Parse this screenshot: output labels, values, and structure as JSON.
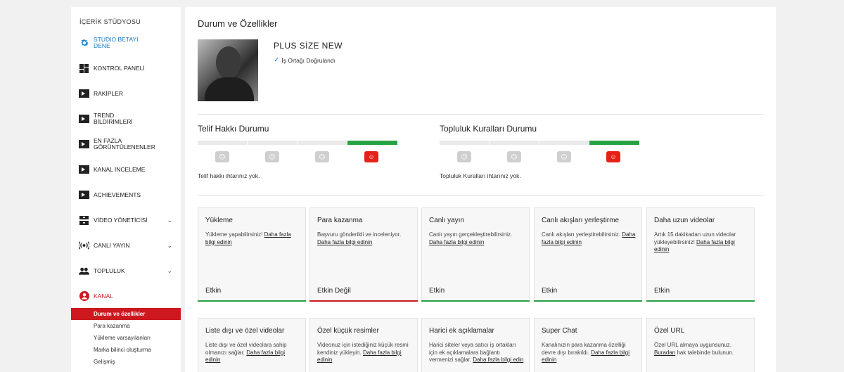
{
  "sidebar": {
    "header": "İÇERİK STÜDYOSU",
    "items": [
      {
        "label": "STUDIO BETAYI DENE",
        "icon": "gear-icon"
      },
      {
        "label": "KONTROL PANELİ",
        "icon": "dashboard-icon"
      },
      {
        "label": "RAKİPLER",
        "icon": "video-thumb-icon"
      },
      {
        "label": "TREND BİLDİRİMLERİ",
        "icon": "video-thumb-icon"
      },
      {
        "label": "EN FAZLA GÖRÜNTÜLENENLER",
        "icon": "video-thumb-icon"
      },
      {
        "label": "KANAL İNCELEME",
        "icon": "video-thumb-icon"
      },
      {
        "label": "ACHIEVEMENTS",
        "icon": "video-thumb-icon"
      },
      {
        "label": "VİDEO YÖNETİCİSİ",
        "icon": "video-manager-icon"
      },
      {
        "label": "CANLI YAYIN",
        "icon": "live-icon"
      },
      {
        "label": "TOPLULUK",
        "icon": "community-icon"
      },
      {
        "label": "KANAL",
        "icon": "account-icon"
      }
    ],
    "subitems": [
      {
        "label": "Durum ve özellikler"
      },
      {
        "label": "Para kazanma"
      },
      {
        "label": "Yükleme varsayılanları"
      },
      {
        "label": "Marka bilinci oluşturma"
      },
      {
        "label": "Gelişmiş"
      }
    ]
  },
  "main": {
    "title": "Durum ve Özellikler",
    "channel_name": "PLUS SİZE NEW",
    "verified_label": "İş Ortağı Doğrulandı",
    "copyright": {
      "title": "Telif Hakkı Durumu",
      "text": "Telif hakkı ihtarınız yok."
    },
    "community": {
      "title": "Topluluk Kuralları Durumu",
      "text": "Topluluk Kuralları ihtarınız yok."
    },
    "cards": [
      {
        "title": "Yükleme",
        "desc": "Yükleme yapabilirsiniz!",
        "link": "Daha fazla bilgi edinin",
        "state": "Etkin"
      },
      {
        "title": "Para kazanma",
        "desc": "Başvuru gönderildi ve inceleniyor.",
        "link": "Daha fazla bilgi edinin",
        "state": "Etkin Değil"
      },
      {
        "title": "Canlı yayın",
        "desc": "Canlı yayın gerçekleştirebilirsiniz.",
        "link": "Daha fazla bilgi edinin",
        "state": "Etkin"
      },
      {
        "title": "Canlı akışları yerleştirme",
        "desc": "Canlı akışları yerleştirebilirsiniz.",
        "link": "Daha fazla bilgi edinin",
        "state": "Etkin"
      },
      {
        "title": "Daha uzun videolar",
        "desc": "Artık 15 dakikadan uzun videolar yükleyebilirsiniz!",
        "link": "Daha fazla bilgi edinin",
        "state": "Etkin"
      },
      {
        "title": "Liste dışı ve özel videolar",
        "desc": "Liste dışı ve özel videolara sahip olmanızı sağlar.",
        "link": "Daha fazla bilgi edinin"
      },
      {
        "title": "Özel küçük resimler",
        "desc": "Videonuz için istediğiniz küçük resmi kendiniz yükleyin.",
        "link": "Daha fazla bilgi edinin"
      },
      {
        "title": "Harici ek açıklamalar",
        "desc": "Harici siteler veya satıcı iş ortakları için ek açıklamalara bağlantı vermenizi sağlar.",
        "link": "Daha fazla bilgi edin"
      },
      {
        "title": "Super Chat",
        "desc": "Kanalınızın para kazanma özelliği devre dışı bırakıldı.",
        "link": "Daha fazla bilgi edinin"
      },
      {
        "title": "Özel URL",
        "desc": "Özel URL almaya uygunsunuz.",
        "link": "Buradan",
        "desc_after": "hak talebinde bulunun."
      }
    ]
  },
  "colors": {
    "accent_blue": "#167ac6",
    "active_red": "#cc181e",
    "green": "#27a243"
  }
}
